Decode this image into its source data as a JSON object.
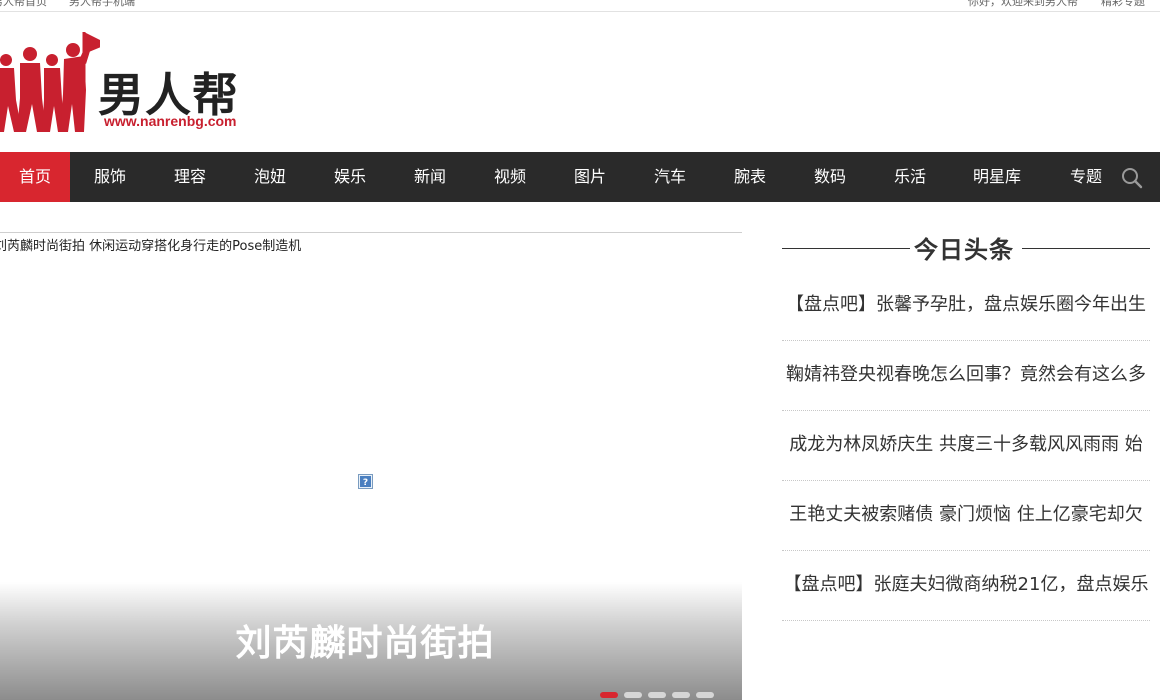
{
  "topbar": {
    "home_link": "男人帮首页",
    "mobile_link": "男人帮手机端",
    "welcome": "你好，欢迎来到男人帮",
    "special_link": "精彩专题"
  },
  "logo": {
    "name": "男人帮",
    "url": "www.nanrenbg.com",
    "accent_color": "#c8202f"
  },
  "nav": {
    "items": [
      {
        "label": "首页",
        "active": true
      },
      {
        "label": "服饰"
      },
      {
        "label": "理容"
      },
      {
        "label": "泡妞"
      },
      {
        "label": "娱乐"
      },
      {
        "label": "新闻"
      },
      {
        "label": "视频"
      },
      {
        "label": "图片"
      },
      {
        "label": "汽车"
      },
      {
        "label": "腕表"
      },
      {
        "label": "数码"
      },
      {
        "label": "乐活"
      },
      {
        "label": "明星库"
      },
      {
        "label": "专题"
      }
    ],
    "search_icon": "search-icon",
    "bg_color": "#2a2a2a",
    "active_color": "#d8262f"
  },
  "slider": {
    "image_alt": "刘芮麟时尚街拍 休闲运动穿搭化身行走的Pose制造机",
    "title": "刘芮麟时尚街拍",
    "dots": 5,
    "active_dot": 0
  },
  "headlines": {
    "title": "今日头条",
    "items": [
      "【盘点吧】张馨予孕肚，盘点娱乐圈今年出生",
      "鞠婧祎登央视春晚怎么回事？竟然会有这么多",
      "成龙为林凤娇庆生 共度三十多载风风雨雨 始",
      "王艳丈夫被索赌债 豪门烦恼 住上亿豪宅却欠",
      "【盘点吧】张庭夫妇微商纳税21亿，盘点娱乐"
    ]
  }
}
